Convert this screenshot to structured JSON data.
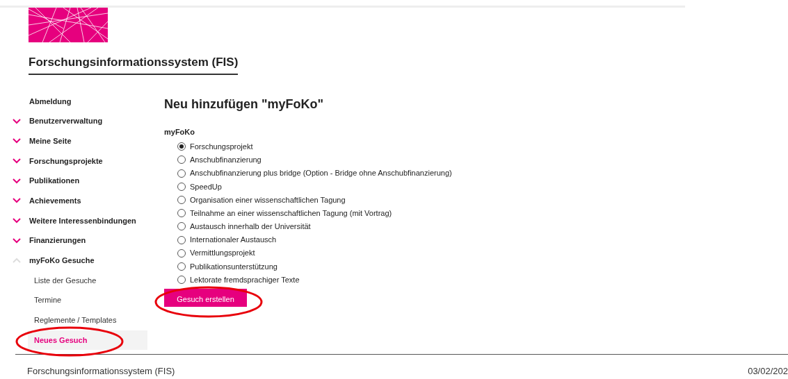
{
  "site_title": "Forschungsinformationssystem (FIS)",
  "sidebar": {
    "items": [
      {
        "label": "Abmeldung",
        "kind": "link"
      },
      {
        "label": "Benutzerverwaltung",
        "kind": "group",
        "expanded": false
      },
      {
        "label": "Meine Seite",
        "kind": "group",
        "expanded": false
      },
      {
        "label": "Forschungsprojekte",
        "kind": "group",
        "expanded": false
      },
      {
        "label": "Publikationen",
        "kind": "group",
        "expanded": false
      },
      {
        "label": "Achievements",
        "kind": "group",
        "expanded": false
      },
      {
        "label": "Weitere Interessenbindungen",
        "kind": "group",
        "expanded": false
      },
      {
        "label": "Finanzierungen",
        "kind": "group",
        "expanded": false
      },
      {
        "label": "myFoKo Gesuche",
        "kind": "group",
        "expanded": true,
        "children": [
          {
            "label": "Liste der Gesuche",
            "selected": false
          },
          {
            "label": "Termine",
            "selected": false
          },
          {
            "label": "Reglemente / Templates",
            "selected": false
          },
          {
            "label": "Neues Gesuch",
            "selected": true
          }
        ]
      }
    ]
  },
  "main": {
    "heading": "Neu hinzufügen \"myFoKo\"",
    "field_label": "myFoKo",
    "options": [
      {
        "label": "Forschungsprojekt",
        "selected": true
      },
      {
        "label": "Anschubfinanzierung",
        "selected": false
      },
      {
        "label": "Anschubfinanzierung plus bridge (Option - Bridge ohne Anschubfinanzierung)",
        "selected": false
      },
      {
        "label": "SpeedUp",
        "selected": false
      },
      {
        "label": "Organisation einer wissenschaftlichen Tagung",
        "selected": false
      },
      {
        "label": "Teilnahme an einer wissenschaftlichen Tagung (mit Vortrag)",
        "selected": false
      },
      {
        "label": "Austausch innerhalb der Universität",
        "selected": false
      },
      {
        "label": "Internationaler Austausch",
        "selected": false
      },
      {
        "label": "Vermittlungsprojekt",
        "selected": false
      },
      {
        "label": "Publikationsunterstützung",
        "selected": false
      },
      {
        "label": "Lektorate fremdsprachiger Texte",
        "selected": false
      }
    ],
    "submit_button": "Gesuch erstellen"
  },
  "footer": {
    "title": "Forschungsinformationssystem (FIS)",
    "date": "03/02/202"
  }
}
